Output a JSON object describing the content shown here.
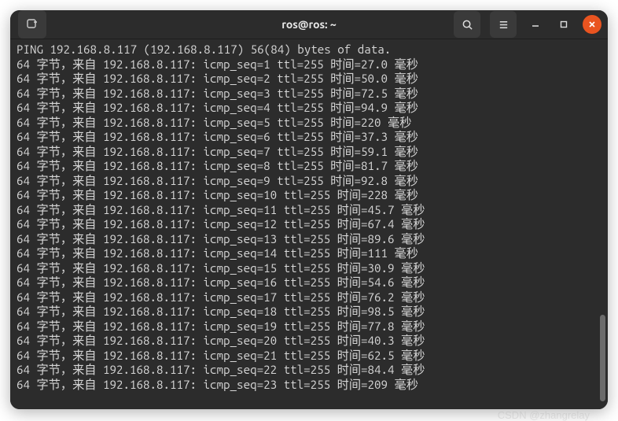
{
  "window": {
    "title": "ros@ros: ~"
  },
  "ping": {
    "header_prefix": "PING",
    "target_ip": "192.168.8.117",
    "header_suffix": "56(84) bytes of data.",
    "bytes_label": "64",
    "unit_label": "字节，来自",
    "ttl": 255,
    "time_label": "时间",
    "ms_label": "毫秒",
    "replies": [
      {
        "seq": 1,
        "time": "27.0"
      },
      {
        "seq": 2,
        "time": "50.0"
      },
      {
        "seq": 3,
        "time": "72.5"
      },
      {
        "seq": 4,
        "time": "94.9"
      },
      {
        "seq": 5,
        "time": "220"
      },
      {
        "seq": 6,
        "time": "37.3"
      },
      {
        "seq": 7,
        "time": "59.1"
      },
      {
        "seq": 8,
        "time": "81.7"
      },
      {
        "seq": 9,
        "time": "92.8"
      },
      {
        "seq": 10,
        "time": "228"
      },
      {
        "seq": 11,
        "time": "45.7"
      },
      {
        "seq": 12,
        "time": "67.4"
      },
      {
        "seq": 13,
        "time": "89.6"
      },
      {
        "seq": 14,
        "time": "111"
      },
      {
        "seq": 15,
        "time": "30.9"
      },
      {
        "seq": 16,
        "time": "54.6"
      },
      {
        "seq": 17,
        "time": "76.2"
      },
      {
        "seq": 18,
        "time": "98.5"
      },
      {
        "seq": 19,
        "time": "77.8"
      },
      {
        "seq": 20,
        "time": "40.3"
      },
      {
        "seq": 21,
        "time": "62.5"
      },
      {
        "seq": 22,
        "time": "84.4"
      },
      {
        "seq": 23,
        "time": "209"
      }
    ]
  },
  "watermark": "CSDN @zhangrelay"
}
